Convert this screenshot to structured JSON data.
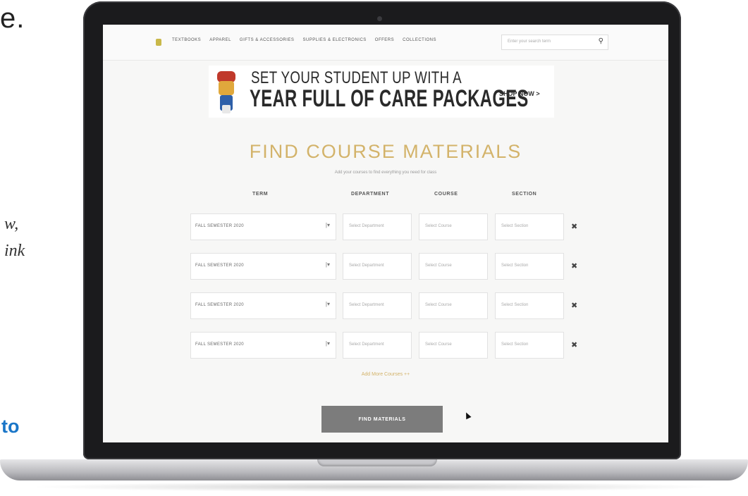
{
  "slide": {
    "top_fragment": "e.",
    "italic_line1": "w,",
    "italic_line2": "ink",
    "link_fragment": "to"
  },
  "nav": {
    "items": [
      "TEXTBOOKS",
      "APPAREL",
      "GIFTS & ACCESSORIES",
      "SUPPLIES & ELECTRONICS",
      "OFFERS",
      "COLLECTIONS"
    ],
    "search_placeholder": "Enter your search term"
  },
  "banner": {
    "line1": "SET YOUR STUDENT UP WITH A",
    "line2": "YEAR FULL OF CARE PACKAGES",
    "cta": "SHOP NOW >"
  },
  "course_finder": {
    "title": "FIND COURSE MATERIALS",
    "subtitle": "Add your courses to find everything you need for class",
    "columns": [
      "TERM",
      "DEPARTMENT",
      "COURSE",
      "SECTION"
    ],
    "rows": [
      {
        "term": "FALL SEMESTER 2020",
        "department": "Select Department",
        "course": "Select Course",
        "section": "Select Section"
      },
      {
        "term": "FALL SEMESTER 2020",
        "department": "Select Department",
        "course": "Select Course",
        "section": "Select Section"
      },
      {
        "term": "FALL SEMESTER 2020",
        "department": "Select Department",
        "course": "Select Course",
        "section": "Select Section"
      },
      {
        "term": "FALL SEMESTER 2020",
        "department": "Select Department",
        "course": "Select Course",
        "section": "Select Section"
      }
    ],
    "add_more": "Add More Courses ++",
    "find_button": "FIND MATERIALS"
  },
  "colors": {
    "accent_gold": "#d3b36a",
    "button_gray": "#7c7c7c",
    "slide_link_blue": "#1a76c8"
  }
}
